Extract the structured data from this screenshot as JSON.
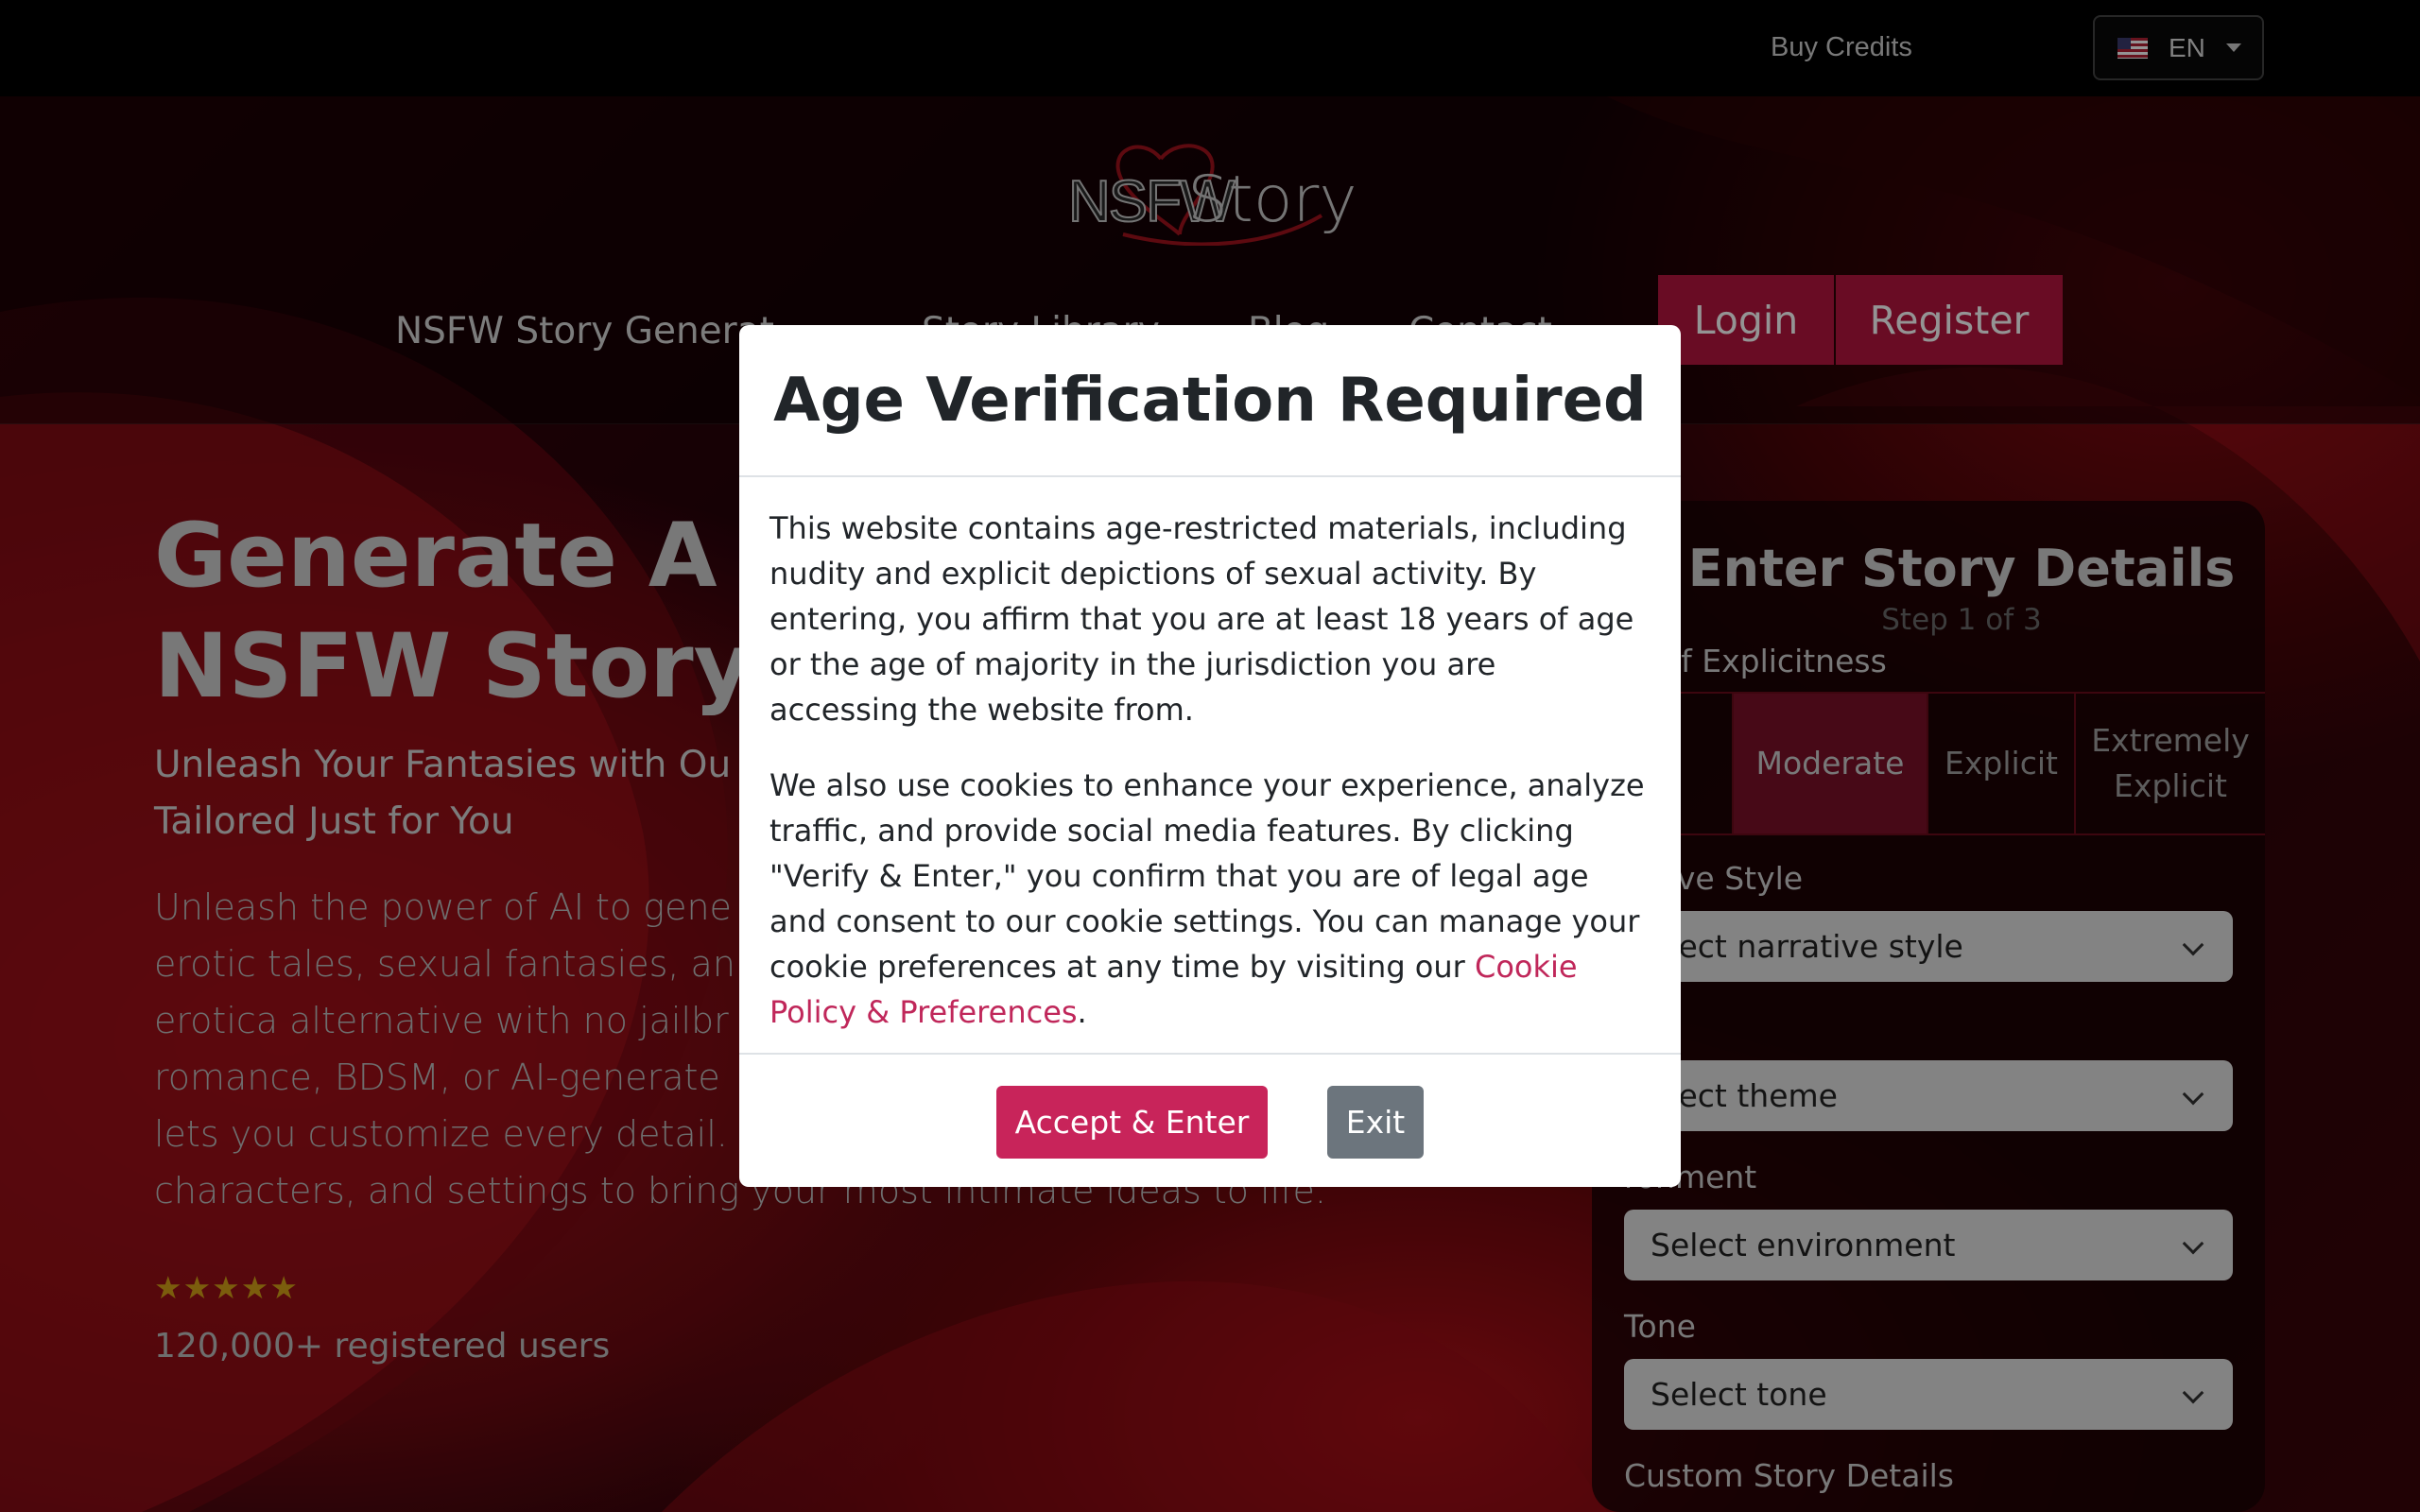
{
  "topbar": {
    "buy_credits": "Buy Credits",
    "language": "EN",
    "flag_icon": "us-flag-icon"
  },
  "logo": {
    "part1": "NSFW",
    "part2": "Story"
  },
  "nav": {
    "items": [
      "NSFW Story Generat",
      "Story Library",
      "Blog",
      "Contact"
    ],
    "login": "Login",
    "register": "Register"
  },
  "hero": {
    "title_line1": "Generate A P",
    "title_line2": "NSFW Story u",
    "subtitle_line1": "Unleash Your Fantasies with Ou",
    "subtitle_line2": "Tailored Just for You",
    "desc_line1": "Unleash the power of AI to gene",
    "desc_line2": "erotic tales, sexual fantasies, an",
    "desc_line3": "erotica alternative with no jailbr",
    "desc_line4": "romance, BDSM, or AI-generate",
    "desc_line5": "lets you customize every detail.",
    "desc_line6": "characters, and settings to bring your most intimate ideas to life.",
    "stars": "★★★★★",
    "users": "120,000+ registered users"
  },
  "story_panel": {
    "title": "Enter Story Details",
    "step": "Step 1 of 3",
    "explicitness_label": "el of Explicitness",
    "levels": [
      "ld",
      "Moderate",
      "Explicit",
      "Extremely Explicit"
    ],
    "active_level": "Moderate",
    "narrative_label": "rative Style",
    "narrative_value": "elect narrative style",
    "theme_label": "me",
    "theme_value": "elect theme",
    "environment_label": "ronment",
    "environment_value": "Select environment",
    "tone_label": "Tone",
    "tone_value": "Select tone",
    "custom_label": "Custom Story Details"
  },
  "modal": {
    "title": "Age Verification Required",
    "para1": "This website contains age-restricted materials, including nudity and explicit depictions of sexual activity. By entering, you affirm that you are at least 18 years of age or the age of majority in the jurisdiction you are accessing the website from.",
    "para2_pre": "We also use cookies to enhance your experience, analyze traffic, and provide social media features. By clicking \"Verify & Enter,\" you confirm that you are of legal age and consent to our cookie settings. You can manage your cookie preferences at any time by visiting our ",
    "para2_link": "Cookie Policy & Preferences",
    "para2_post": ".",
    "accept": "Accept & Enter",
    "exit": "Exit"
  },
  "colors": {
    "brand": "#b5163f",
    "accept": "#c8245a",
    "exit": "#6c757d",
    "link": "#c0275a"
  }
}
